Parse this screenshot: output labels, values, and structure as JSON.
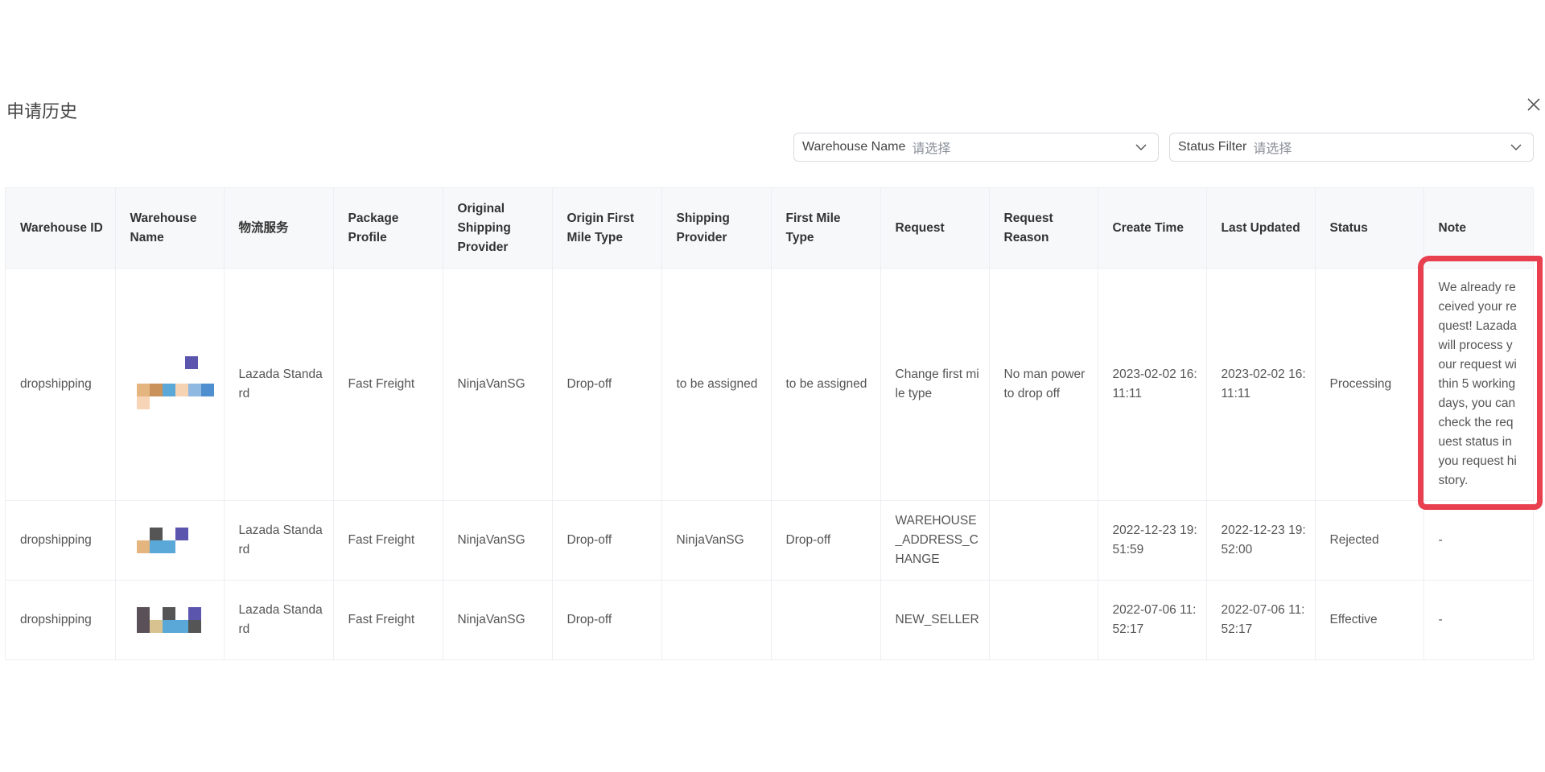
{
  "dialog": {
    "title": "申请历史",
    "close_icon": "close-icon"
  },
  "filters": {
    "warehouse_label": "Warehouse Name",
    "warehouse_placeholder": "请选择",
    "status_label": "Status Filter",
    "status_placeholder": "请选择"
  },
  "table": {
    "headers": [
      "Warehouse ID",
      "Warehouse Name",
      "物流服务",
      "Package Profile",
      "Original Shipping Provider",
      "Origin First Mile Type",
      "Shipping Provider",
      "First Mile Type",
      "Request",
      "Request Reason",
      "Create Time",
      "Last Updated",
      "Status",
      "Note"
    ],
    "rows": [
      {
        "warehouse_id": "dropshipping",
        "warehouse_name": "",
        "logistics": "Lazada Standard",
        "package_profile": "Fast Freight",
        "original_provider": "NinjaVanSG",
        "origin_first_mile": "Drop-off",
        "shipping_provider": "to be assigned",
        "first_mile_type": "to be assigned",
        "request": "Change first mile type",
        "request_reason": "No man power to drop off",
        "create_time": "2023-02-02 16:11:11",
        "last_updated": "2023-02-02 16:11:11",
        "status": "Processing",
        "note": "We already received your request! Lazada will process your request within 5 working days, you can check the request status in you request history."
      },
      {
        "warehouse_id": "dropshipping",
        "warehouse_name": "",
        "logistics": "Lazada Standard",
        "package_profile": "Fast Freight",
        "original_provider": "NinjaVanSG",
        "origin_first_mile": "Drop-off",
        "shipping_provider": "NinjaVanSG",
        "first_mile_type": "Drop-off",
        "request": "WAREHOUSE_ADDRESS_CHANGE",
        "request_reason": "",
        "create_time": "2022-12-23 19:51:59",
        "last_updated": "2022-12-23 19:52:00",
        "status": "Rejected",
        "note": "-"
      },
      {
        "warehouse_id": "dropshipping",
        "warehouse_name": "",
        "logistics": "Lazada Standard",
        "package_profile": "Fast Freight",
        "original_provider": "NinjaVanSG",
        "origin_first_mile": "Drop-off",
        "shipping_provider": "",
        "first_mile_type": "",
        "request": "NEW_SELLER",
        "request_reason": "",
        "create_time": "2022-07-06 11:52:17",
        "last_updated": "2022-07-06 11:52:17",
        "status": "Effective",
        "note": "-"
      }
    ]
  },
  "colors": {
    "highlight": "#e8404f",
    "header_bg": "#f7f8fa",
    "border": "#eceef2"
  }
}
